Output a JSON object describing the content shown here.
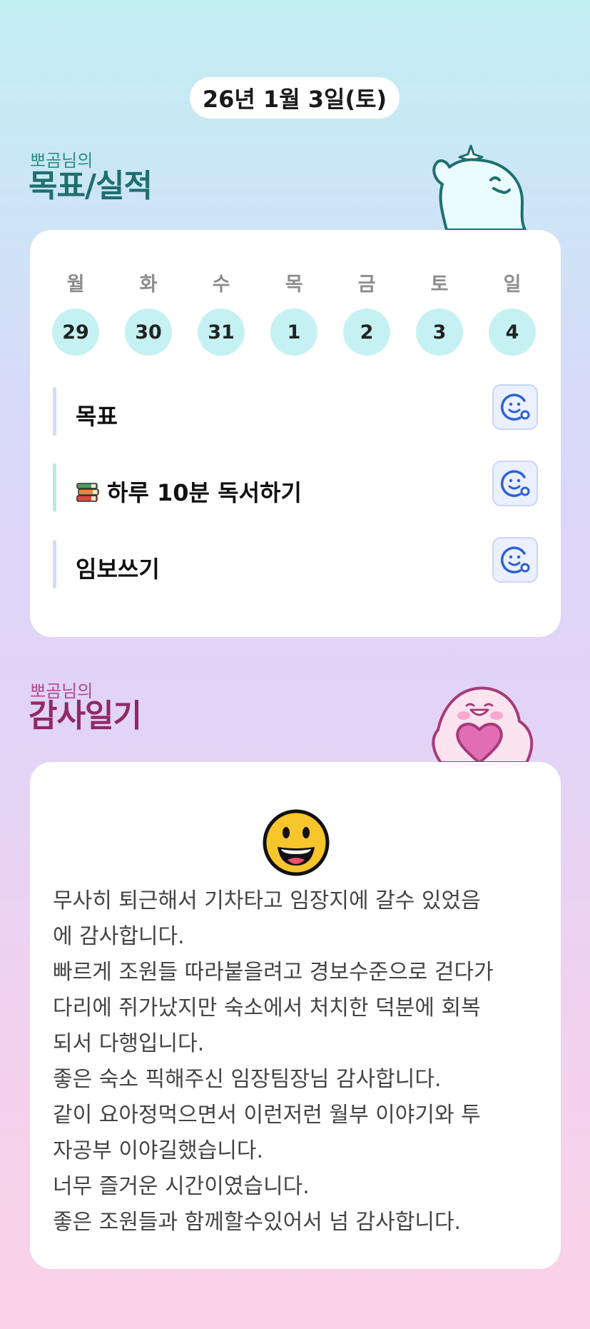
{
  "date": "26년 1월 3일(토)",
  "goals_section": {
    "owner": "뽀곰님의",
    "title": "목표/실적",
    "weekdays": [
      "월",
      "화",
      "수",
      "목",
      "금",
      "토",
      "일"
    ],
    "days": [
      "29",
      "30",
      "31",
      "1",
      "2",
      "3",
      "4"
    ],
    "items": [
      {
        "label": "목표",
        "bar_color": "#d3dbfa",
        "icon": null
      },
      {
        "label": "하루 10분 독서하기",
        "bar_color": "#b9ecd9",
        "icon": "books-icon"
      },
      {
        "label": "임보쓰기",
        "bar_color": "#d3dbfa",
        "icon": null
      }
    ]
  },
  "gratitude_section": {
    "owner": "뽀곰님의",
    "title": "감사일기",
    "mood_icon": "grinning-face-icon",
    "text": "무사히 퇴근해서 기차타고 임장지에 갈수 있었음\n에 감사합니다.\n빠르게 조원들 따라붙을려고 경보수준으로 걷다가\n다리에 쥐가났지만 숙소에서 처치한 덕분에 회복\n되서 다행입니다.\n좋은 숙소 픽해주신 임장팀장님 감사합니다.\n같이 요아정먹으면서 이런저런 월부 이야기와 투\n자공부 이야길했습니다.\n너무 즐거운 시간이였습니다.\n좋은 조원들과 함께할수있어서 넘 감사합니다."
  }
}
